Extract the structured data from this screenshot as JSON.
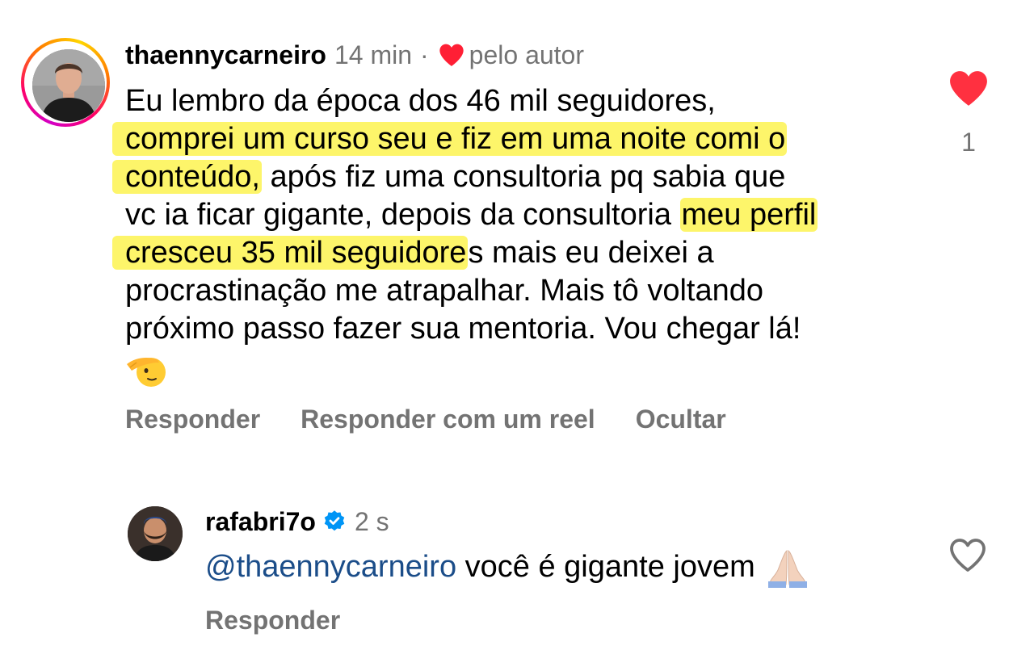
{
  "comment": {
    "username": "thaennycarneiro",
    "time": "14 min",
    "separator": "·",
    "author_tag": "pelo autor",
    "lines": [
      {
        "before": "Eu lembro da época dos 46 mil seguidores,",
        "highlight": "",
        "after": ""
      },
      {
        "before": "",
        "highlight": "comprei um curso seu e fiz em uma noite comi o",
        "after": ""
      },
      {
        "before": "",
        "highlight": "conteúdo,",
        "after": " após fiz uma consultoria pq sabia que"
      },
      {
        "before": "vc ia ficar gigante, depois da consultoria ",
        "highlight": "meu perfil",
        "after": ""
      },
      {
        "before": "",
        "highlight": "cresceu 35 mil seguidore",
        "after": "s mais eu deixei a"
      },
      {
        "before": "procrastinação me atrapalhar. Mais tô voltando",
        "highlight": "",
        "after": ""
      },
      {
        "before": "próximo passo fazer sua mentoria. Vou chegar lá!",
        "highlight": "",
        "after": ""
      }
    ],
    "emoji": "saluting-face",
    "like_count": "1",
    "actions": {
      "reply": "Responder",
      "reply_reel": "Responder com um reel",
      "hide": "Ocultar"
    }
  },
  "reply": {
    "username": "rafabri7o",
    "time": "2 s",
    "mention": "@thaennycarneiro",
    "text": " você é gigante jovem",
    "emoji": "folded-hands",
    "reply_label": "Responder"
  },
  "colors": {
    "highlight": "#fdf56a",
    "meta_gray": "#737373",
    "like_red": "#ff3040",
    "verified_blue": "#0095f6",
    "mention_blue": "#1b4d89"
  }
}
